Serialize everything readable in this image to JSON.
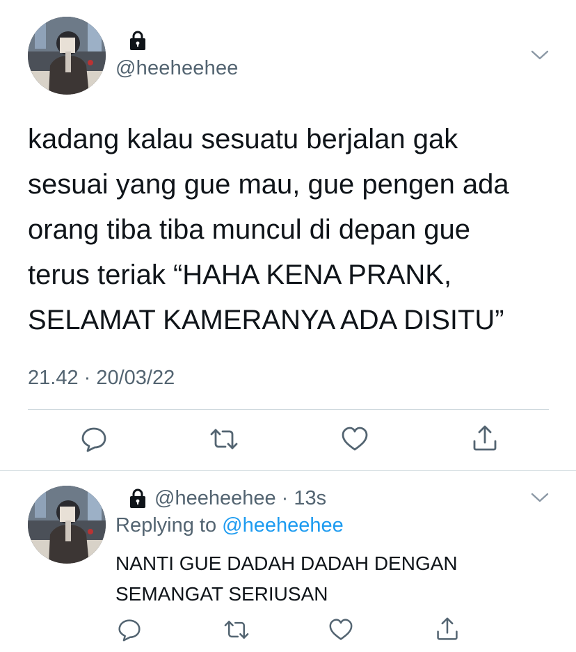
{
  "main_tweet": {
    "username_display": "",
    "handle": "@heeheehee",
    "protected_icon": "lock-icon",
    "menu_icon": "chevron-down-icon",
    "text_lines": [
      "kadang kalau sesuatu berjalan gak",
      "sesuai yang gue mau, gue pengen ada",
      "orang tiba tiba muncul di depan gue",
      "terus teriak “HAHA KENA PRANK,",
      "SELAMAT KAMERANYA ADA DISITU”"
    ],
    "meta": "21.42 · 20/03/22",
    "actions": {
      "reply_icon": "reply-icon",
      "retweet_icon": "retweet-icon",
      "like_icon": "heart-icon",
      "share_icon": "share-icon"
    }
  },
  "reply_tweet": {
    "handle_time": "@heeheehee · 13s",
    "protected_icon": "lock-icon",
    "menu_icon": "chevron-down-icon",
    "replying_prefix": "Replying to ",
    "replying_mention": "@heeheehee",
    "text_lines": [
      "NANTI GUE DADAH DADAH DENGAN",
      "SEMANGAT SERIUSAN"
    ],
    "actions": {
      "reply_icon": "reply-icon",
      "retweet_icon": "retweet-icon",
      "like_icon": "heart-icon",
      "share_icon": "share-icon"
    }
  },
  "colors": {
    "text_primary": "#0f1419",
    "text_secondary": "#536471",
    "mention_blue": "#1d9bf0",
    "divider": "#cfd9de"
  }
}
